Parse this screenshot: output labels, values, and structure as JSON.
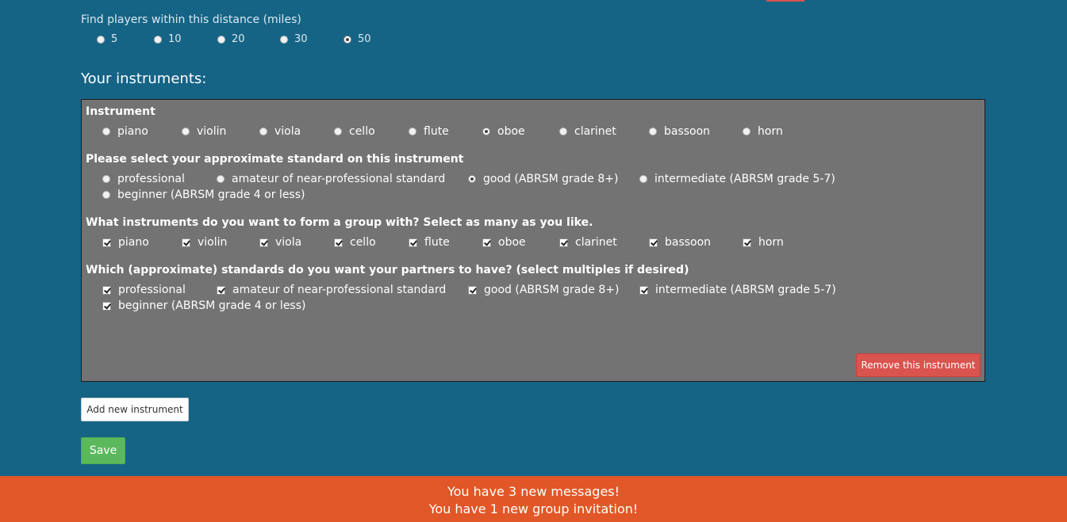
{
  "distance": {
    "title": "Find players within this distance (miles)",
    "options": [
      "5",
      "10",
      "20",
      "30",
      "50"
    ],
    "selected": "50"
  },
  "instruments_heading": "Your instruments:",
  "panel": {
    "instrument_label": "Instrument",
    "instruments": [
      "piano",
      "violin",
      "viola",
      "cello",
      "flute",
      "oboe",
      "clarinet",
      "bassoon",
      "horn"
    ],
    "selected_instrument": "oboe",
    "standard_label": "Please select your approximate standard on this instrument",
    "standards": [
      "professional",
      "amateur of near-professional standard",
      "good (ABRSM grade 8+)",
      "intermediate (ABRSM grade 5-7)",
      "beginner (ABRSM grade 4 or less)"
    ],
    "selected_standard": "good (ABRSM grade 8+)",
    "group_label": "What instruments do you want to form a group with? Select as many as you like.",
    "group_instruments_checked": [
      true,
      true,
      true,
      true,
      true,
      true,
      true,
      true,
      true
    ],
    "partner_label": "Which (approximate) standards do you want your partners to have? (select multiples if desired)",
    "partner_standards_checked": [
      true,
      true,
      true,
      true,
      true
    ],
    "remove_label": "Remove this instrument"
  },
  "add_label": "Add new instrument",
  "save_label": "Save",
  "notifications": {
    "messages": "You have 3 new messages!",
    "invitations": "You have 1 new group invitation!"
  },
  "colors": {
    "background": "#156486",
    "panel": "#737373",
    "danger": "#d9534f",
    "success": "#5cb85c",
    "notification": "#e15727"
  }
}
